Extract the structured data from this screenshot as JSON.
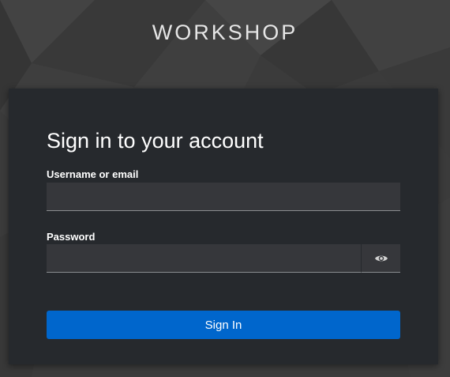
{
  "brand": {
    "name": "WORKSHOP"
  },
  "login": {
    "title": "Sign in to your account",
    "username_label": "Username or email",
    "username_value": "",
    "password_label": "Password",
    "password_value": "",
    "show_password_icon": "eye-icon",
    "submit_label": "Sign In"
  },
  "colors": {
    "background": "#3c3c3c",
    "card": "#26292d",
    "input": "#36373b",
    "primary": "#0066cc",
    "text": "#ffffff"
  }
}
